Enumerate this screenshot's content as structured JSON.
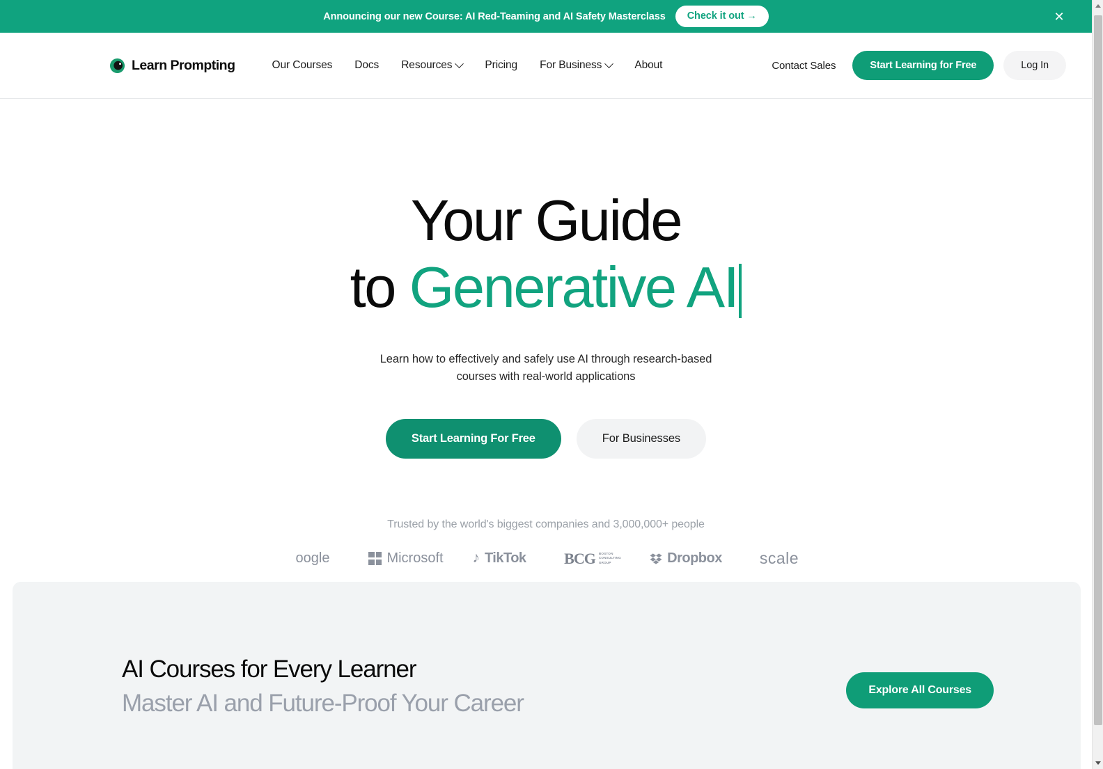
{
  "announcement": {
    "text": "Announcing our new Course: AI Red-Teaming and AI Safety Masterclass",
    "cta_label": "Check it out →",
    "close_icon": "close-icon",
    "bg_color": "#10a37f"
  },
  "header": {
    "brand_name": "Learn Prompting",
    "brand_mark_icon": "learn-prompting-logo-icon",
    "nav": [
      {
        "label": "Our Courses",
        "has_chevron": false
      },
      {
        "label": "Docs",
        "has_chevron": false
      },
      {
        "label": "Resources",
        "has_chevron": true
      },
      {
        "label": "Pricing",
        "has_chevron": false
      },
      {
        "label": "For Business",
        "has_chevron": true
      },
      {
        "label": "About",
        "has_chevron": false
      }
    ],
    "contact_sales_label": "Contact Sales",
    "start_free_label": "Start Learning for Free",
    "login_label": "Log In"
  },
  "hero": {
    "title_line1": "Your Guide",
    "title_line2_prefix": "to ",
    "title_line2_accent": "Generative AI",
    "accent_color": "#11a37f",
    "subtitle_line1": "Learn how to effectively and safely use AI through research-based",
    "subtitle_line2": "courses with real-world applications",
    "primary_cta": "Start Learning For Free",
    "secondary_cta": "For Businesses"
  },
  "trusted": {
    "label": "Trusted by the world's biggest companies and 3,000,000+ people",
    "logos": [
      {
        "name": "google-logo",
        "text": "oogle"
      },
      {
        "name": "microsoft-logo",
        "text": "Microsoft"
      },
      {
        "name": "tiktok-logo",
        "text": "TikTok",
        "glyph": "♪"
      },
      {
        "name": "bcg-logo",
        "text": "BCG",
        "sub1": "BOSTON",
        "sub2": "CONSULTING",
        "sub3": "GROUP"
      },
      {
        "name": "dropbox-logo",
        "text": "Dropbox"
      },
      {
        "name": "scale-logo",
        "text": "scale"
      }
    ]
  },
  "courses": {
    "title": "AI Courses for Every Learner",
    "subtitle": "Master AI and Future-Proof Your Career",
    "explore_label": "Explore All Courses"
  }
}
